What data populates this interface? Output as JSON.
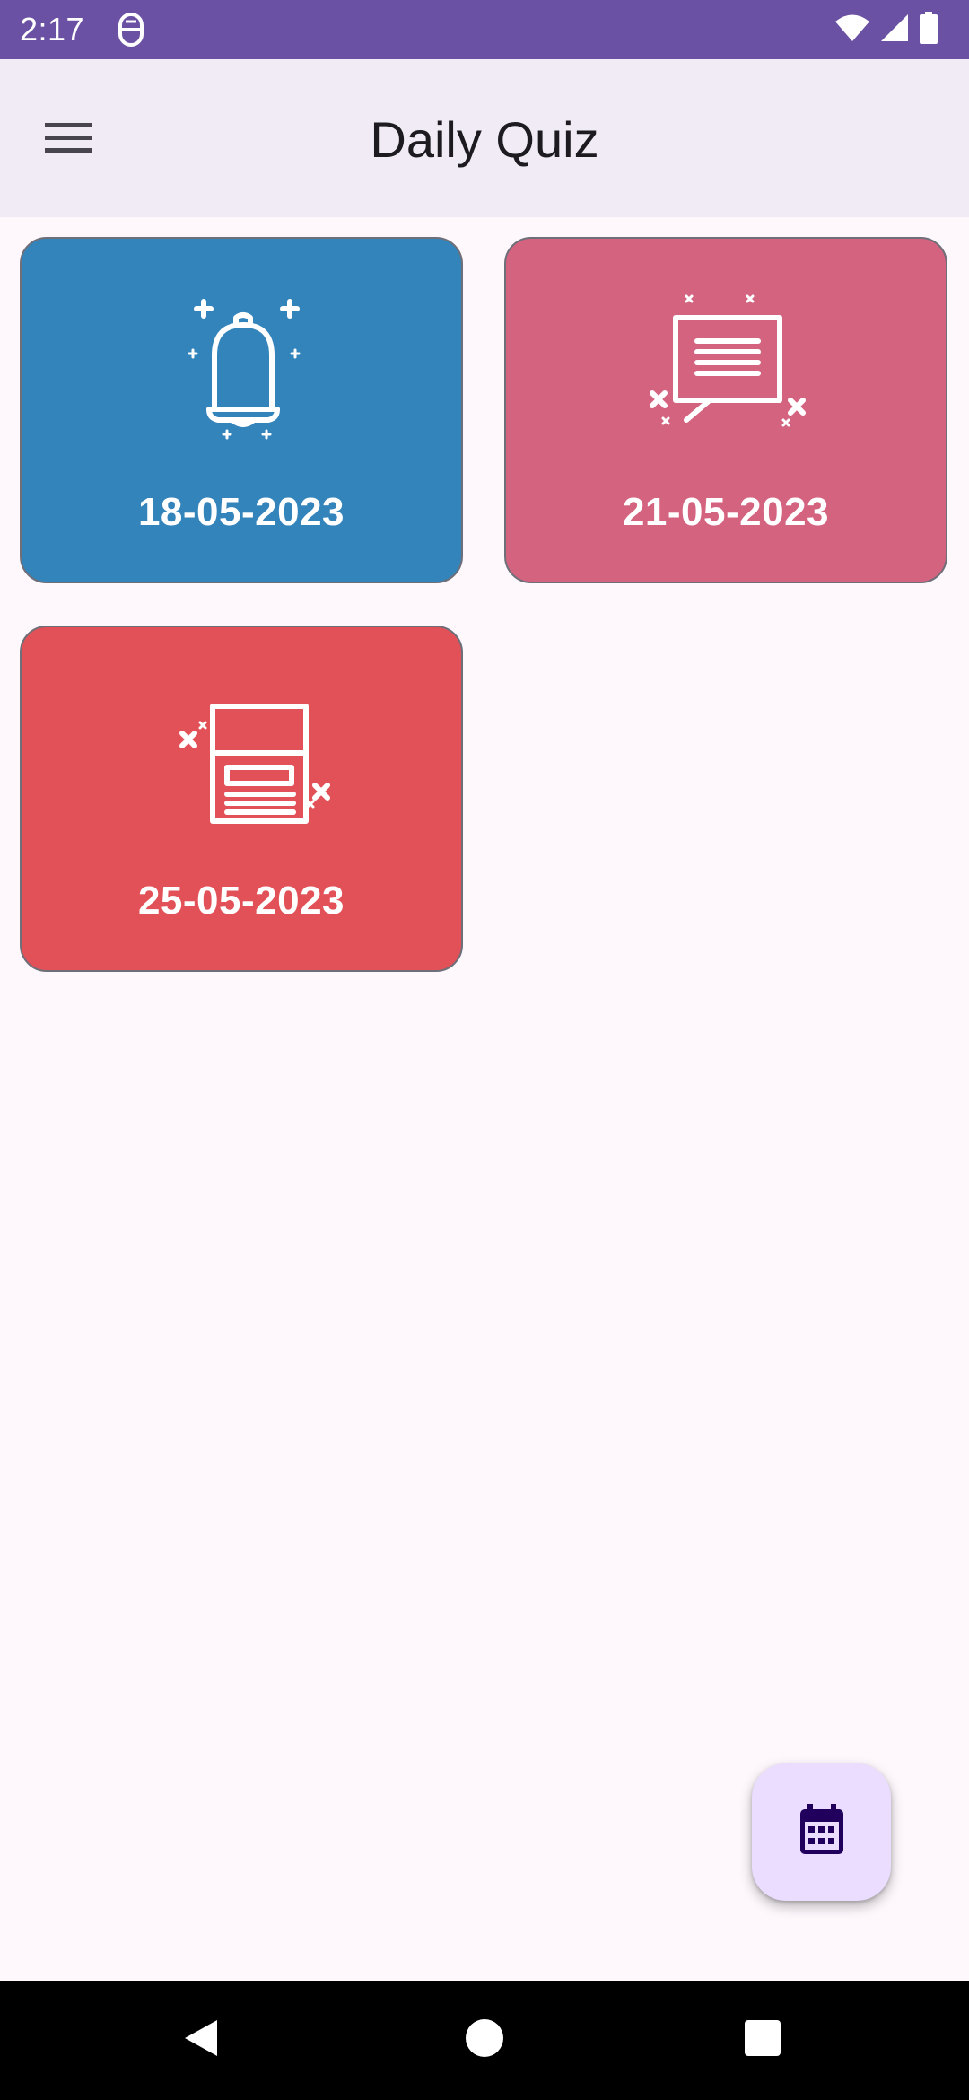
{
  "status_bar": {
    "time": "2:17",
    "icons": [
      "app-notification-icon",
      "wifi-icon",
      "signal-icon",
      "battery-icon"
    ]
  },
  "app_bar": {
    "title": "Daily Quiz",
    "menu_icon": "hamburger-menu-icon"
  },
  "quizzes": [
    {
      "date": "18-05-2023",
      "icon": "bell-icon",
      "color": "#3484BC"
    },
    {
      "date": "21-05-2023",
      "icon": "message-board-icon",
      "color": "#D46380"
    },
    {
      "date": "25-05-2023",
      "icon": "document-icon",
      "color": "#E35158"
    }
  ],
  "fab": {
    "icon": "calendar-icon"
  },
  "nav_bar": {
    "icons": [
      "back-icon",
      "home-icon",
      "recents-icon"
    ]
  },
  "colors": {
    "status_bar": "#6A51A3",
    "app_bar": "#F0EBF5",
    "background": "#FEF8FD",
    "fab_background": "#EADDFF",
    "fab_icon": "#21005D"
  }
}
